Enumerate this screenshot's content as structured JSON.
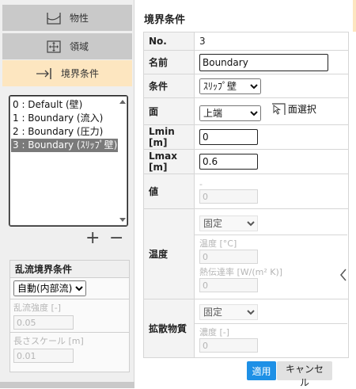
{
  "nav": {
    "items": [
      {
        "label": "物性",
        "icon": "properties-icon",
        "active": false
      },
      {
        "label": "領域",
        "icon": "region-icon",
        "active": false
      },
      {
        "label": "境界条件",
        "icon": "boundary-icon",
        "active": true
      }
    ]
  },
  "boundary_list": {
    "items": [
      {
        "label": "0 : Default (壁)",
        "selected": false
      },
      {
        "label": "1 : Boundary (流入)",
        "selected": false
      },
      {
        "label": "2 : Boundary (圧力)",
        "selected": false
      },
      {
        "label": "3 : Boundary (ｽﾘｯﾌﾟ壁)",
        "selected": true
      }
    ],
    "add_label": "+",
    "remove_label": "−"
  },
  "turbulence": {
    "header": "乱流境界条件",
    "mode_value": "自動(内部流)",
    "intensity_label": "乱流強度 [-]",
    "intensity_value": "0.05",
    "length_label": "長さスケール [m]",
    "length_value": "0.01"
  },
  "form": {
    "title": "境界条件",
    "no_label": "No.",
    "no_value": "3",
    "name_label": "名前",
    "name_value": "Boundary",
    "condition_label": "条件",
    "condition_value": "ｽﾘｯﾌﾟ壁",
    "face_label": "面",
    "face_value": "上端",
    "face_select_label": "面選択",
    "lmin_label": "Lmin [m]",
    "lmin_value": "0",
    "lmax_label": "Lmax [m]",
    "lmax_value": "0.6",
    "value_label": "値",
    "value_sub_label": "-",
    "value_value": "0",
    "temp_label": "温度",
    "temp_mode": "固定",
    "temp_sub_label": "温度 [°C]",
    "temp_value": "0",
    "htc_label": "熱伝達率 [W/(m² K)]",
    "htc_value": "0",
    "diff_label": "拡散物質",
    "diff_mode": "固定",
    "conc_label": "濃度 [-]",
    "conc_value": "0"
  },
  "buttons": {
    "apply": "適用",
    "cancel": "キャンセル"
  },
  "colors": {
    "active_tab": "#fde6c0",
    "primary_button": "#1e90e6",
    "selected_row": "#7a7a7a"
  }
}
